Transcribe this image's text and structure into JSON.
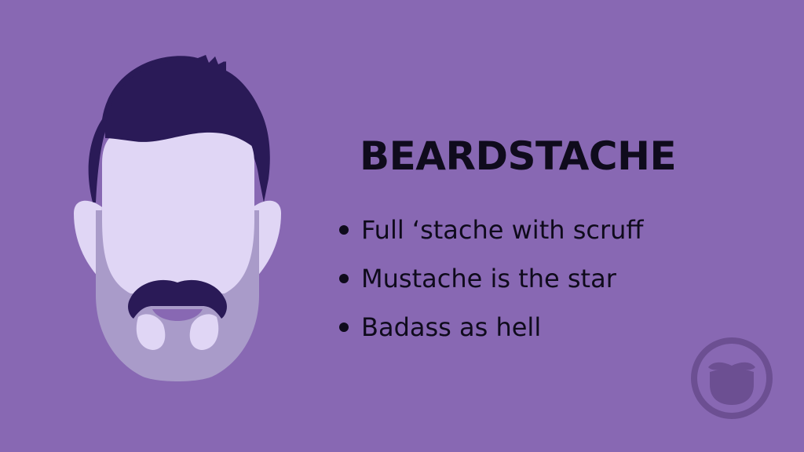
{
  "slide": {
    "title": "BEARDSTACHE",
    "bullets": [
      "Full ‘stache with scruff",
      "Mustache is the star",
      "Badass as hell"
    ]
  },
  "illustration": {
    "icon": "beardstache-face-icon"
  },
  "logo": {
    "icon": "beard-logo-icon"
  },
  "colors": {
    "background": "#8868b3",
    "hair": "#2a1a57",
    "skin": "#e0d6f5",
    "scruff": "#a99bc9",
    "text": "#0f0b1c",
    "logo": "#6c4f92"
  }
}
